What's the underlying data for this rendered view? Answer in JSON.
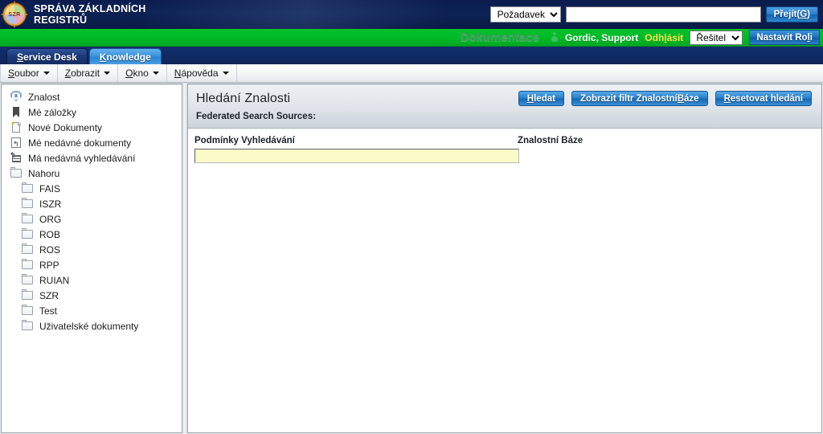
{
  "banner": {
    "logo_text": "SZR",
    "logo_icon": "szr-emblem-icon",
    "title_line1": "SPRÁVA ZÁKLADNÍCH",
    "title_line2": "REGISTRŮ",
    "request_select": {
      "value": "Požadavek",
      "options": [
        "Požadavek"
      ]
    },
    "search_value": "",
    "search_placeholder": "",
    "go_button": {
      "pre": "Přejít(",
      "accel": "G",
      "post": ")"
    },
    "bg_color": "#0d2355"
  },
  "greenbar": {
    "documentation_label": "Dokumentace",
    "user_icon": "user-icon",
    "user_name": "Gordic, Support",
    "logout": {
      "pre": "Odh",
      "accel": "l",
      "post": "ásit"
    },
    "role_select": {
      "value": "Řešitel",
      "options": [
        "Řešitel"
      ]
    },
    "set_role_button": {
      "pre": "Nastavit Ro",
      "accel": "l",
      "post": "i"
    },
    "bg_color": "#00bb27"
  },
  "tabs": [
    {
      "pre": "",
      "accel": "S",
      "post": "ervice Desk",
      "active": false
    },
    {
      "pre": "",
      "accel": "K",
      "post": "nowledge",
      "active": true
    }
  ],
  "menubar": [
    {
      "pre": "",
      "accel": "S",
      "post": "oubor"
    },
    {
      "pre": "",
      "accel": "Z",
      "post": "obrazit"
    },
    {
      "pre": "",
      "accel": "O",
      "post": "kno"
    },
    {
      "pre": "",
      "accel": "N",
      "post": "ápověda"
    }
  ],
  "sidebar": {
    "root": {
      "label": "Znalost",
      "icon": "knowledge-badge-icon"
    },
    "items": [
      {
        "label": "Mé záložky",
        "icon": "bookmark-icon",
        "type": "bookmark"
      },
      {
        "label": "Nové Dokumenty",
        "icon": "new-document-icon",
        "type": "newdoc"
      },
      {
        "label": "Mé nedávné dokumenty",
        "icon": "recent-document-icon",
        "type": "recdoc"
      },
      {
        "label": "Má nedávná vyhledávání",
        "icon": "recent-search-icon",
        "type": "recsearch"
      },
      {
        "label": "Nahoru",
        "icon": "folder-icon",
        "type": "folder"
      }
    ],
    "folders": [
      {
        "label": "FAIS",
        "icon": "folder-icon"
      },
      {
        "label": "ISZR",
        "icon": "folder-icon"
      },
      {
        "label": "ORG",
        "icon": "folder-icon"
      },
      {
        "label": "ROB",
        "icon": "folder-icon"
      },
      {
        "label": "ROS",
        "icon": "folder-icon"
      },
      {
        "label": "RPP",
        "icon": "folder-icon"
      },
      {
        "label": "RUIAN",
        "icon": "folder-icon"
      },
      {
        "label": "SZR",
        "icon": "folder-icon"
      },
      {
        "label": "Test",
        "icon": "folder-icon"
      },
      {
        "label": "Uživatelské dokumenty",
        "icon": "folder-icon"
      }
    ]
  },
  "main": {
    "title": "Hledání Znalosti",
    "buttons": [
      {
        "pre": "",
        "accel": "H",
        "post": "ledat"
      },
      {
        "pre": "Zobrazit filtr Znalostní ",
        "accel": "B",
        "post": "áze"
      },
      {
        "pre": "",
        "accel": "R",
        "post": "esetovat hledání"
      }
    ],
    "federated_label": "Federated Search Sources:",
    "field_label": "Podmínky Vyhledávání",
    "field_value": "",
    "field_placeholder": "",
    "right_label": "Znalostní Báze",
    "accent_color": "#2b83cd",
    "field_bg": "#fbfbc8"
  }
}
